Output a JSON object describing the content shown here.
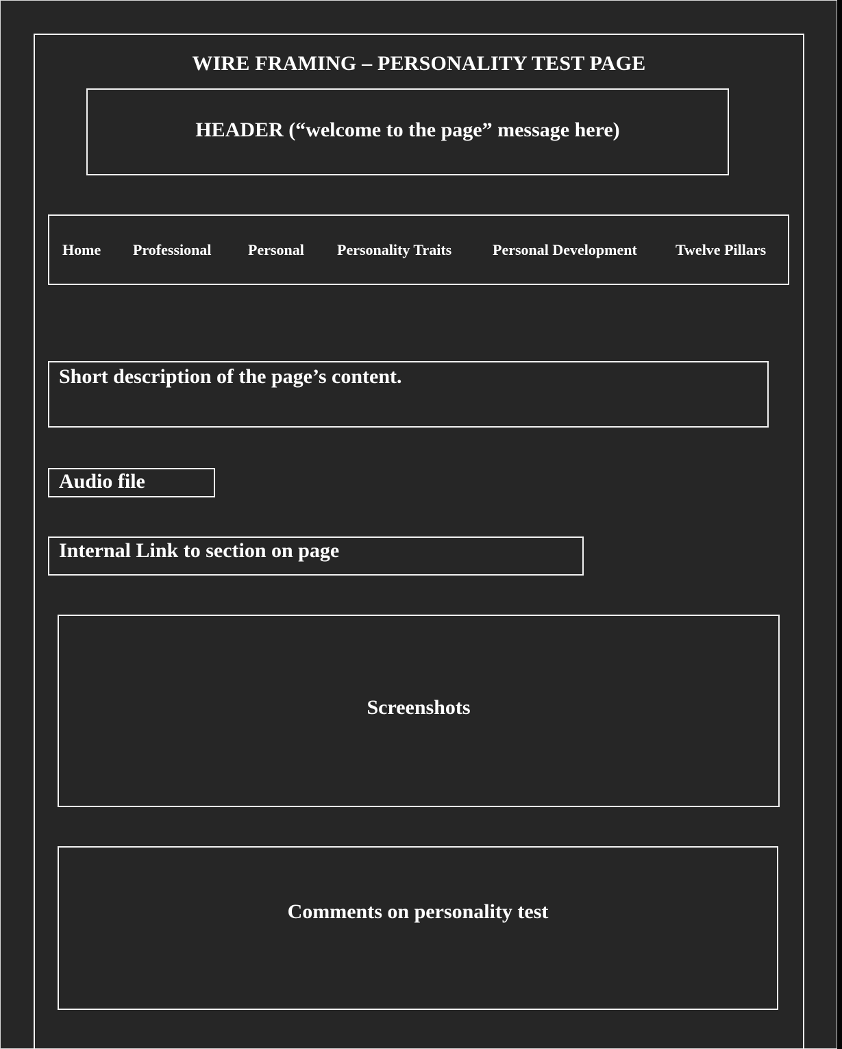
{
  "page_title": "WIRE FRAMING – PERSONALITY TEST PAGE",
  "header": {
    "text": "HEADER (“welcome to the page” message here)"
  },
  "nav": {
    "items": [
      {
        "label": "Home"
      },
      {
        "label": "Professional"
      },
      {
        "label": "Personal"
      },
      {
        "label": "Personality Traits"
      },
      {
        "label": "Personal Development"
      },
      {
        "label": "Twelve Pillars"
      }
    ]
  },
  "description": {
    "text": "Short description of the page’s content."
  },
  "audio": {
    "text": "Audio file"
  },
  "internal_link": {
    "text": "Internal Link to section on page"
  },
  "screenshots": {
    "text": "Screenshots"
  },
  "comments": {
    "text": "Comments on personality test"
  },
  "colors": {
    "background": "#262626",
    "lines": "#f2f2f2",
    "text": "#ffffff"
  }
}
